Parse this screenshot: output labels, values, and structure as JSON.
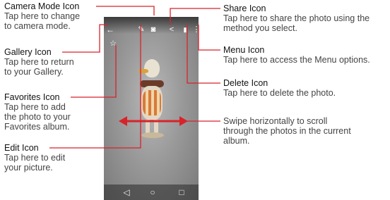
{
  "callouts": {
    "camera": {
      "title": "Camera Mode Icon",
      "desc": [
        "Tap here to change",
        "to camera mode."
      ]
    },
    "gallery": {
      "title": "Gallery Icon",
      "desc": [
        "Tap here to return",
        "to your Gallery."
      ]
    },
    "favorites": {
      "title": "Favorites Icon",
      "desc": [
        "Tap here to add",
        "the photo to your",
        "Favorites album."
      ]
    },
    "edit": {
      "title": "Edit Icon",
      "desc": [
        "Tap here to edit",
        "your picture."
      ]
    },
    "share": {
      "title": "Share Icon",
      "desc": [
        "Tap here to share the photo using the",
        "method you select."
      ]
    },
    "menu": {
      "title": "Menu Icon",
      "desc": [
        "Tap here to access the Menu options."
      ]
    },
    "delete": {
      "title": "Delete Icon",
      "desc": [
        "Tap here to delete the photo."
      ]
    },
    "swipe": {
      "desc": [
        "Swipe horizontally to scroll",
        "through the photos in the current",
        "album."
      ]
    }
  },
  "phone_icons": {
    "back": "←",
    "favorite": "☆",
    "edit": "✎",
    "camera": "◙",
    "share": "<",
    "delete": "▮",
    "menu": "⋮"
  },
  "nav_icons": {
    "back": "◁",
    "home": "○",
    "recent": "□"
  },
  "colors": {
    "callout_line": "#d8232a"
  }
}
